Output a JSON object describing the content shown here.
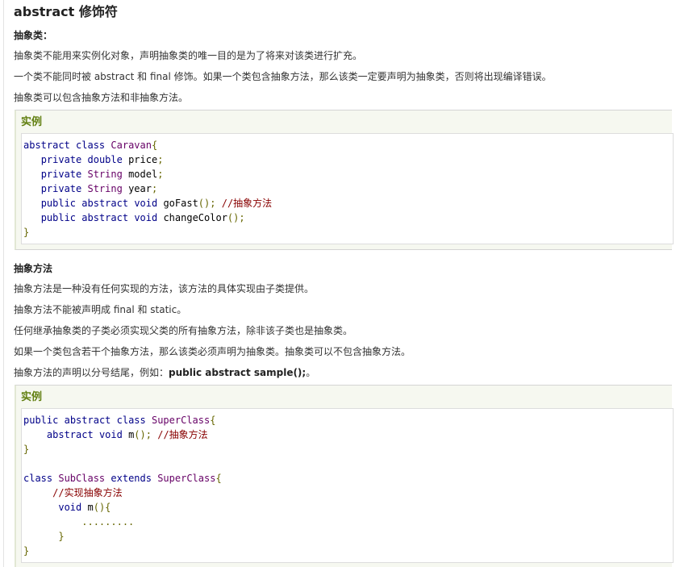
{
  "page": {
    "title": "abstract 修饰符"
  },
  "section_abstract_class": {
    "heading": "抽象类：",
    "paragraphs": [
      "抽象类不能用来实例化对象，声明抽象类的唯一目的是为了将来对该类进行扩充。",
      "一个类不能同时被 abstract 和 final 修饰。如果一个类包含抽象方法，那么该类一定要声明为抽象类，否则将出现编译错误。",
      "抽象类可以包含抽象方法和非抽象方法。"
    ],
    "example_title": "实例",
    "code_lines": [
      [
        {
          "t": "kwd",
          "v": "abstract"
        },
        {
          "t": "pln",
          "v": " "
        },
        {
          "t": "kwd",
          "v": "class"
        },
        {
          "t": "pln",
          "v": " "
        },
        {
          "t": "typ",
          "v": "Caravan"
        },
        {
          "t": "pun",
          "v": "{"
        }
      ],
      [
        {
          "t": "pln",
          "v": "   "
        },
        {
          "t": "kwd",
          "v": "private"
        },
        {
          "t": "pln",
          "v": " "
        },
        {
          "t": "kwd",
          "v": "double"
        },
        {
          "t": "pln",
          "v": " price"
        },
        {
          "t": "pun",
          "v": ";"
        }
      ],
      [
        {
          "t": "pln",
          "v": "   "
        },
        {
          "t": "kwd",
          "v": "private"
        },
        {
          "t": "pln",
          "v": " "
        },
        {
          "t": "typ",
          "v": "String"
        },
        {
          "t": "pln",
          "v": " model"
        },
        {
          "t": "pun",
          "v": ";"
        }
      ],
      [
        {
          "t": "pln",
          "v": "   "
        },
        {
          "t": "kwd",
          "v": "private"
        },
        {
          "t": "pln",
          "v": " "
        },
        {
          "t": "typ",
          "v": "String"
        },
        {
          "t": "pln",
          "v": " year"
        },
        {
          "t": "pun",
          "v": ";"
        }
      ],
      [
        {
          "t": "pln",
          "v": "   "
        },
        {
          "t": "kwd",
          "v": "public"
        },
        {
          "t": "pln",
          "v": " "
        },
        {
          "t": "kwd",
          "v": "abstract"
        },
        {
          "t": "pln",
          "v": " "
        },
        {
          "t": "kwd",
          "v": "void"
        },
        {
          "t": "pln",
          "v": " goFast"
        },
        {
          "t": "pun",
          "v": "();"
        },
        {
          "t": "pln",
          "v": " "
        },
        {
          "t": "com",
          "v": "//抽象方法"
        }
      ],
      [
        {
          "t": "pln",
          "v": "   "
        },
        {
          "t": "kwd",
          "v": "public"
        },
        {
          "t": "pln",
          "v": " "
        },
        {
          "t": "kwd",
          "v": "abstract"
        },
        {
          "t": "pln",
          "v": " "
        },
        {
          "t": "kwd",
          "v": "void"
        },
        {
          "t": "pln",
          "v": " changeColor"
        },
        {
          "t": "pun",
          "v": "();"
        }
      ],
      [
        {
          "t": "pun",
          "v": "}"
        }
      ]
    ]
  },
  "section_abstract_method": {
    "heading": "抽象方法",
    "paragraphs": [
      "抽象方法是一种没有任何实现的方法，该方法的具体实现由子类提供。",
      "抽象方法不能被声明成 final 和 static。",
      "任何继承抽象类的子类必须实现父类的所有抽象方法，除非该子类也是抽象类。",
      "如果一个类包含若干个抽象方法，那么该类必须声明为抽象类。抽象类可以不包含抽象方法。"
    ],
    "last_paragraph_prefix": "抽象方法的声明以分号结尾，例如：",
    "last_paragraph_bold": "public abstract sample();",
    "last_paragraph_suffix": "。",
    "example_title": "实例",
    "code_lines": [
      [
        {
          "t": "kwd",
          "v": "public"
        },
        {
          "t": "pln",
          "v": " "
        },
        {
          "t": "kwd",
          "v": "abstract"
        },
        {
          "t": "pln",
          "v": " "
        },
        {
          "t": "kwd",
          "v": "class"
        },
        {
          "t": "pln",
          "v": " "
        },
        {
          "t": "typ",
          "v": "SuperClass"
        },
        {
          "t": "pun",
          "v": "{"
        }
      ],
      [
        {
          "t": "pln",
          "v": "    "
        },
        {
          "t": "kwd",
          "v": "abstract"
        },
        {
          "t": "pln",
          "v": " "
        },
        {
          "t": "kwd",
          "v": "void"
        },
        {
          "t": "pln",
          "v": " m"
        },
        {
          "t": "pun",
          "v": "();"
        },
        {
          "t": "pln",
          "v": " "
        },
        {
          "t": "com",
          "v": "//抽象方法"
        }
      ],
      [
        {
          "t": "pun",
          "v": "}"
        }
      ],
      [
        {
          "t": "pln",
          "v": " "
        }
      ],
      [
        {
          "t": "kwd",
          "v": "class"
        },
        {
          "t": "pln",
          "v": " "
        },
        {
          "t": "typ",
          "v": "SubClass"
        },
        {
          "t": "pln",
          "v": " "
        },
        {
          "t": "kwd",
          "v": "extends"
        },
        {
          "t": "pln",
          "v": " "
        },
        {
          "t": "typ",
          "v": "SuperClass"
        },
        {
          "t": "pun",
          "v": "{"
        }
      ],
      [
        {
          "t": "pln",
          "v": "     "
        },
        {
          "t": "com",
          "v": "//实现抽象方法"
        }
      ],
      [
        {
          "t": "pln",
          "v": "      "
        },
        {
          "t": "kwd",
          "v": "void"
        },
        {
          "t": "pln",
          "v": " m"
        },
        {
          "t": "pun",
          "v": "(){"
        }
      ],
      [
        {
          "t": "pln",
          "v": "          "
        },
        {
          "t": "pun",
          "v": "........."
        }
      ],
      [
        {
          "t": "pln",
          "v": "      "
        },
        {
          "t": "pun",
          "v": "}"
        }
      ],
      [
        {
          "t": "pun",
          "v": "}"
        }
      ]
    ]
  }
}
